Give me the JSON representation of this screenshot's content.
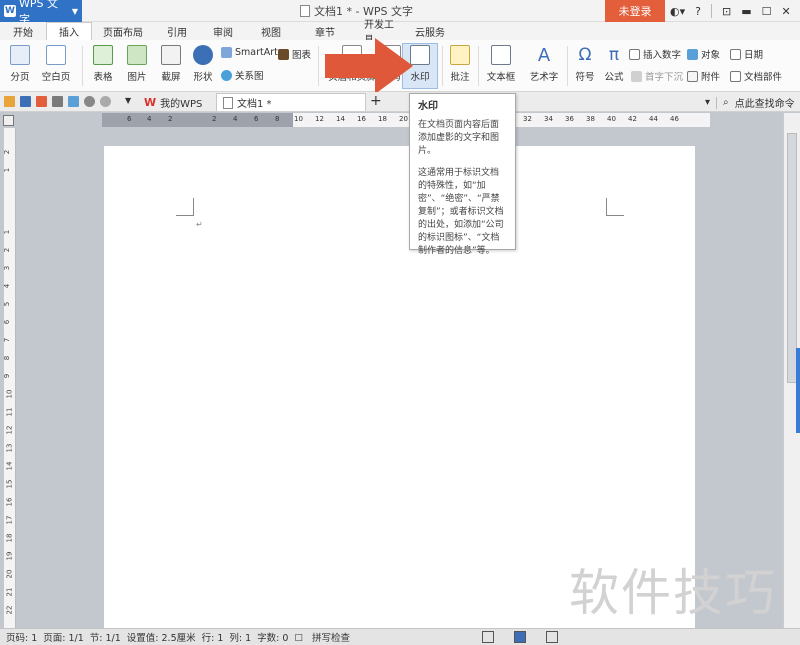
{
  "titlebar": {
    "app_button": "WPS 文字",
    "doc_title": "文档1 * - WPS 文字",
    "login": "未登录",
    "help": "?"
  },
  "menu": {
    "tabs": [
      "开始",
      "插入",
      "页面布局",
      "引用",
      "审阅",
      "视图",
      "章节",
      "开发工具",
      "云服务"
    ],
    "active": "插入"
  },
  "ribbon": {
    "page_break": "分页",
    "blank_page": "空白页",
    "table": "表格",
    "picture": "图片",
    "screenshot": "截屏",
    "shapes": "形状",
    "smartart": "SmartArt",
    "chart": "图表",
    "relation": "关系图",
    "header_footer": "页眉和页脚",
    "page_number": "页码",
    "watermark": "水印",
    "comment": "批注",
    "textbox": "文本框",
    "wordart": "艺术字",
    "symbol": "符号",
    "formula": "公式",
    "insert_number": "插入数字",
    "object": "对象",
    "date": "日期",
    "drop_cap": "首字下沉",
    "attachment": "附件",
    "doc_parts": "文档部件"
  },
  "tabsbar": {
    "home_tab": "我的WPS",
    "doc_tab": "文档1 *",
    "command_search": "点此查找命令"
  },
  "ruler": {
    "h_numbers": [
      "6",
      "4",
      "2",
      "2",
      "4",
      "6",
      "8",
      "10",
      "12",
      "14",
      "16",
      "18",
      "20",
      "32",
      "34",
      "36",
      "38",
      "40",
      "42",
      "44",
      "46"
    ],
    "v_numbers": [
      "2",
      "1",
      "1",
      "2",
      "3",
      "4",
      "5",
      "6",
      "7",
      "8",
      "9",
      "10",
      "11",
      "12",
      "13",
      "14",
      "15",
      "16",
      "17",
      "18",
      "19",
      "20",
      "21",
      "22",
      "23",
      "24",
      "25",
      "26"
    ]
  },
  "tooltip": {
    "title": "水印",
    "line1": "在文档页面内容后面添加虚影的文字和图片。",
    "line2": "这通常用于标识文档的特殊性，如“加密”、“绝密”、“严禁复制”；或者标识文档的出处，如添加“公司的标识图标”、“文档制作者的信息”等。"
  },
  "status": {
    "page_num": "页码: 1",
    "pages": "页面: 1/1",
    "section": "节: 1/1",
    "setting": "设置值: 2.5厘米",
    "row": "行: 1",
    "col": "列: 1",
    "words": "字数: 0",
    "spell": "拼写检查"
  },
  "watermark_text": "软件技巧",
  "colors": {
    "accent": "#2f72c6",
    "login": "#e35e3b",
    "arrow": "#e0583a"
  }
}
